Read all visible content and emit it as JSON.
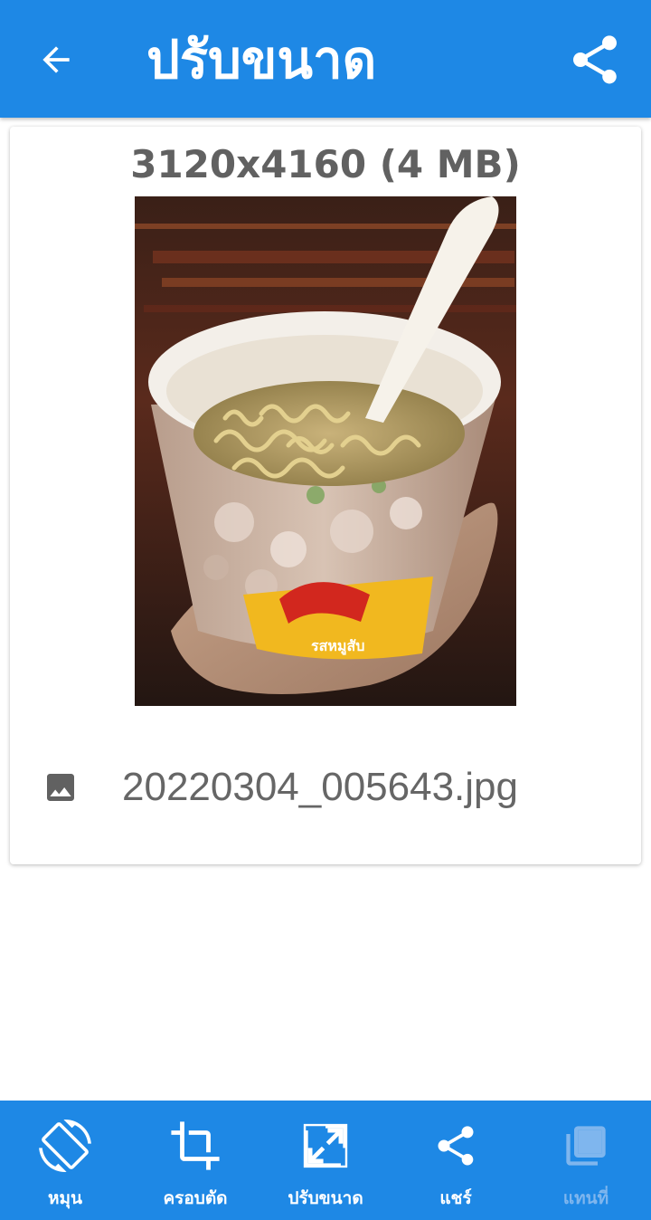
{
  "header": {
    "title": "ปรับขนาด",
    "back_icon": "arrow-back-icon",
    "share_icon": "share-icon"
  },
  "card": {
    "dimensions": "3120x4160 (4 MB)",
    "file_name": "20220304_005643.jpg",
    "file_icon": "image-icon"
  },
  "bottom_nav": {
    "items": [
      {
        "label": "หมุน",
        "icon": "rotate-icon",
        "enabled": true
      },
      {
        "label": "ครอบตัด",
        "icon": "crop-icon",
        "enabled": true
      },
      {
        "label": "ปรับขนาด",
        "icon": "resize-icon",
        "enabled": true
      },
      {
        "label": "แชร์",
        "icon": "share-icon",
        "enabled": true
      },
      {
        "label": "แทนที่",
        "icon": "replace-icon",
        "enabled": false
      }
    ]
  },
  "colors": {
    "primary": "#1e88e5",
    "disabled_label": "#7fb6ee",
    "text_secondary": "#616161"
  }
}
